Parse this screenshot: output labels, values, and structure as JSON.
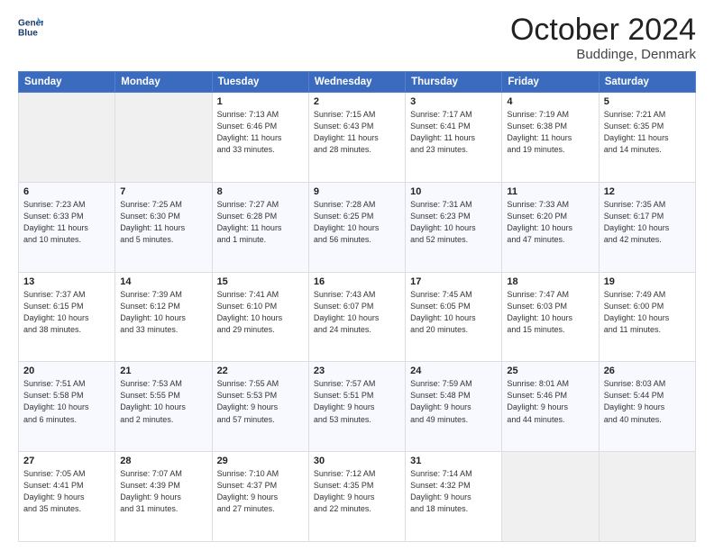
{
  "header": {
    "logo_line1": "General",
    "logo_line2": "Blue",
    "main_title": "October 2024",
    "subtitle": "Buddinge, Denmark"
  },
  "calendar": {
    "days_of_week": [
      "Sunday",
      "Monday",
      "Tuesday",
      "Wednesday",
      "Thursday",
      "Friday",
      "Saturday"
    ],
    "weeks": [
      [
        {
          "day": "",
          "info": ""
        },
        {
          "day": "",
          "info": ""
        },
        {
          "day": "1",
          "info": "Sunrise: 7:13 AM\nSunset: 6:46 PM\nDaylight: 11 hours\nand 33 minutes."
        },
        {
          "day": "2",
          "info": "Sunrise: 7:15 AM\nSunset: 6:43 PM\nDaylight: 11 hours\nand 28 minutes."
        },
        {
          "day": "3",
          "info": "Sunrise: 7:17 AM\nSunset: 6:41 PM\nDaylight: 11 hours\nand 23 minutes."
        },
        {
          "day": "4",
          "info": "Sunrise: 7:19 AM\nSunset: 6:38 PM\nDaylight: 11 hours\nand 19 minutes."
        },
        {
          "day": "5",
          "info": "Sunrise: 7:21 AM\nSunset: 6:35 PM\nDaylight: 11 hours\nand 14 minutes."
        }
      ],
      [
        {
          "day": "6",
          "info": "Sunrise: 7:23 AM\nSunset: 6:33 PM\nDaylight: 11 hours\nand 10 minutes."
        },
        {
          "day": "7",
          "info": "Sunrise: 7:25 AM\nSunset: 6:30 PM\nDaylight: 11 hours\nand 5 minutes."
        },
        {
          "day": "8",
          "info": "Sunrise: 7:27 AM\nSunset: 6:28 PM\nDaylight: 11 hours\nand 1 minute."
        },
        {
          "day": "9",
          "info": "Sunrise: 7:28 AM\nSunset: 6:25 PM\nDaylight: 10 hours\nand 56 minutes."
        },
        {
          "day": "10",
          "info": "Sunrise: 7:31 AM\nSunset: 6:23 PM\nDaylight: 10 hours\nand 52 minutes."
        },
        {
          "day": "11",
          "info": "Sunrise: 7:33 AM\nSunset: 6:20 PM\nDaylight: 10 hours\nand 47 minutes."
        },
        {
          "day": "12",
          "info": "Sunrise: 7:35 AM\nSunset: 6:17 PM\nDaylight: 10 hours\nand 42 minutes."
        }
      ],
      [
        {
          "day": "13",
          "info": "Sunrise: 7:37 AM\nSunset: 6:15 PM\nDaylight: 10 hours\nand 38 minutes."
        },
        {
          "day": "14",
          "info": "Sunrise: 7:39 AM\nSunset: 6:12 PM\nDaylight: 10 hours\nand 33 minutes."
        },
        {
          "day": "15",
          "info": "Sunrise: 7:41 AM\nSunset: 6:10 PM\nDaylight: 10 hours\nand 29 minutes."
        },
        {
          "day": "16",
          "info": "Sunrise: 7:43 AM\nSunset: 6:07 PM\nDaylight: 10 hours\nand 24 minutes."
        },
        {
          "day": "17",
          "info": "Sunrise: 7:45 AM\nSunset: 6:05 PM\nDaylight: 10 hours\nand 20 minutes."
        },
        {
          "day": "18",
          "info": "Sunrise: 7:47 AM\nSunset: 6:03 PM\nDaylight: 10 hours\nand 15 minutes."
        },
        {
          "day": "19",
          "info": "Sunrise: 7:49 AM\nSunset: 6:00 PM\nDaylight: 10 hours\nand 11 minutes."
        }
      ],
      [
        {
          "day": "20",
          "info": "Sunrise: 7:51 AM\nSunset: 5:58 PM\nDaylight: 10 hours\nand 6 minutes."
        },
        {
          "day": "21",
          "info": "Sunrise: 7:53 AM\nSunset: 5:55 PM\nDaylight: 10 hours\nand 2 minutes."
        },
        {
          "day": "22",
          "info": "Sunrise: 7:55 AM\nSunset: 5:53 PM\nDaylight: 9 hours\nand 57 minutes."
        },
        {
          "day": "23",
          "info": "Sunrise: 7:57 AM\nSunset: 5:51 PM\nDaylight: 9 hours\nand 53 minutes."
        },
        {
          "day": "24",
          "info": "Sunrise: 7:59 AM\nSunset: 5:48 PM\nDaylight: 9 hours\nand 49 minutes."
        },
        {
          "day": "25",
          "info": "Sunrise: 8:01 AM\nSunset: 5:46 PM\nDaylight: 9 hours\nand 44 minutes."
        },
        {
          "day": "26",
          "info": "Sunrise: 8:03 AM\nSunset: 5:44 PM\nDaylight: 9 hours\nand 40 minutes."
        }
      ],
      [
        {
          "day": "27",
          "info": "Sunrise: 7:05 AM\nSunset: 4:41 PM\nDaylight: 9 hours\nand 35 minutes."
        },
        {
          "day": "28",
          "info": "Sunrise: 7:07 AM\nSunset: 4:39 PM\nDaylight: 9 hours\nand 31 minutes."
        },
        {
          "day": "29",
          "info": "Sunrise: 7:10 AM\nSunset: 4:37 PM\nDaylight: 9 hours\nand 27 minutes."
        },
        {
          "day": "30",
          "info": "Sunrise: 7:12 AM\nSunset: 4:35 PM\nDaylight: 9 hours\nand 22 minutes."
        },
        {
          "day": "31",
          "info": "Sunrise: 7:14 AM\nSunset: 4:32 PM\nDaylight: 9 hours\nand 18 minutes."
        },
        {
          "day": "",
          "info": ""
        },
        {
          "day": "",
          "info": ""
        }
      ]
    ]
  }
}
